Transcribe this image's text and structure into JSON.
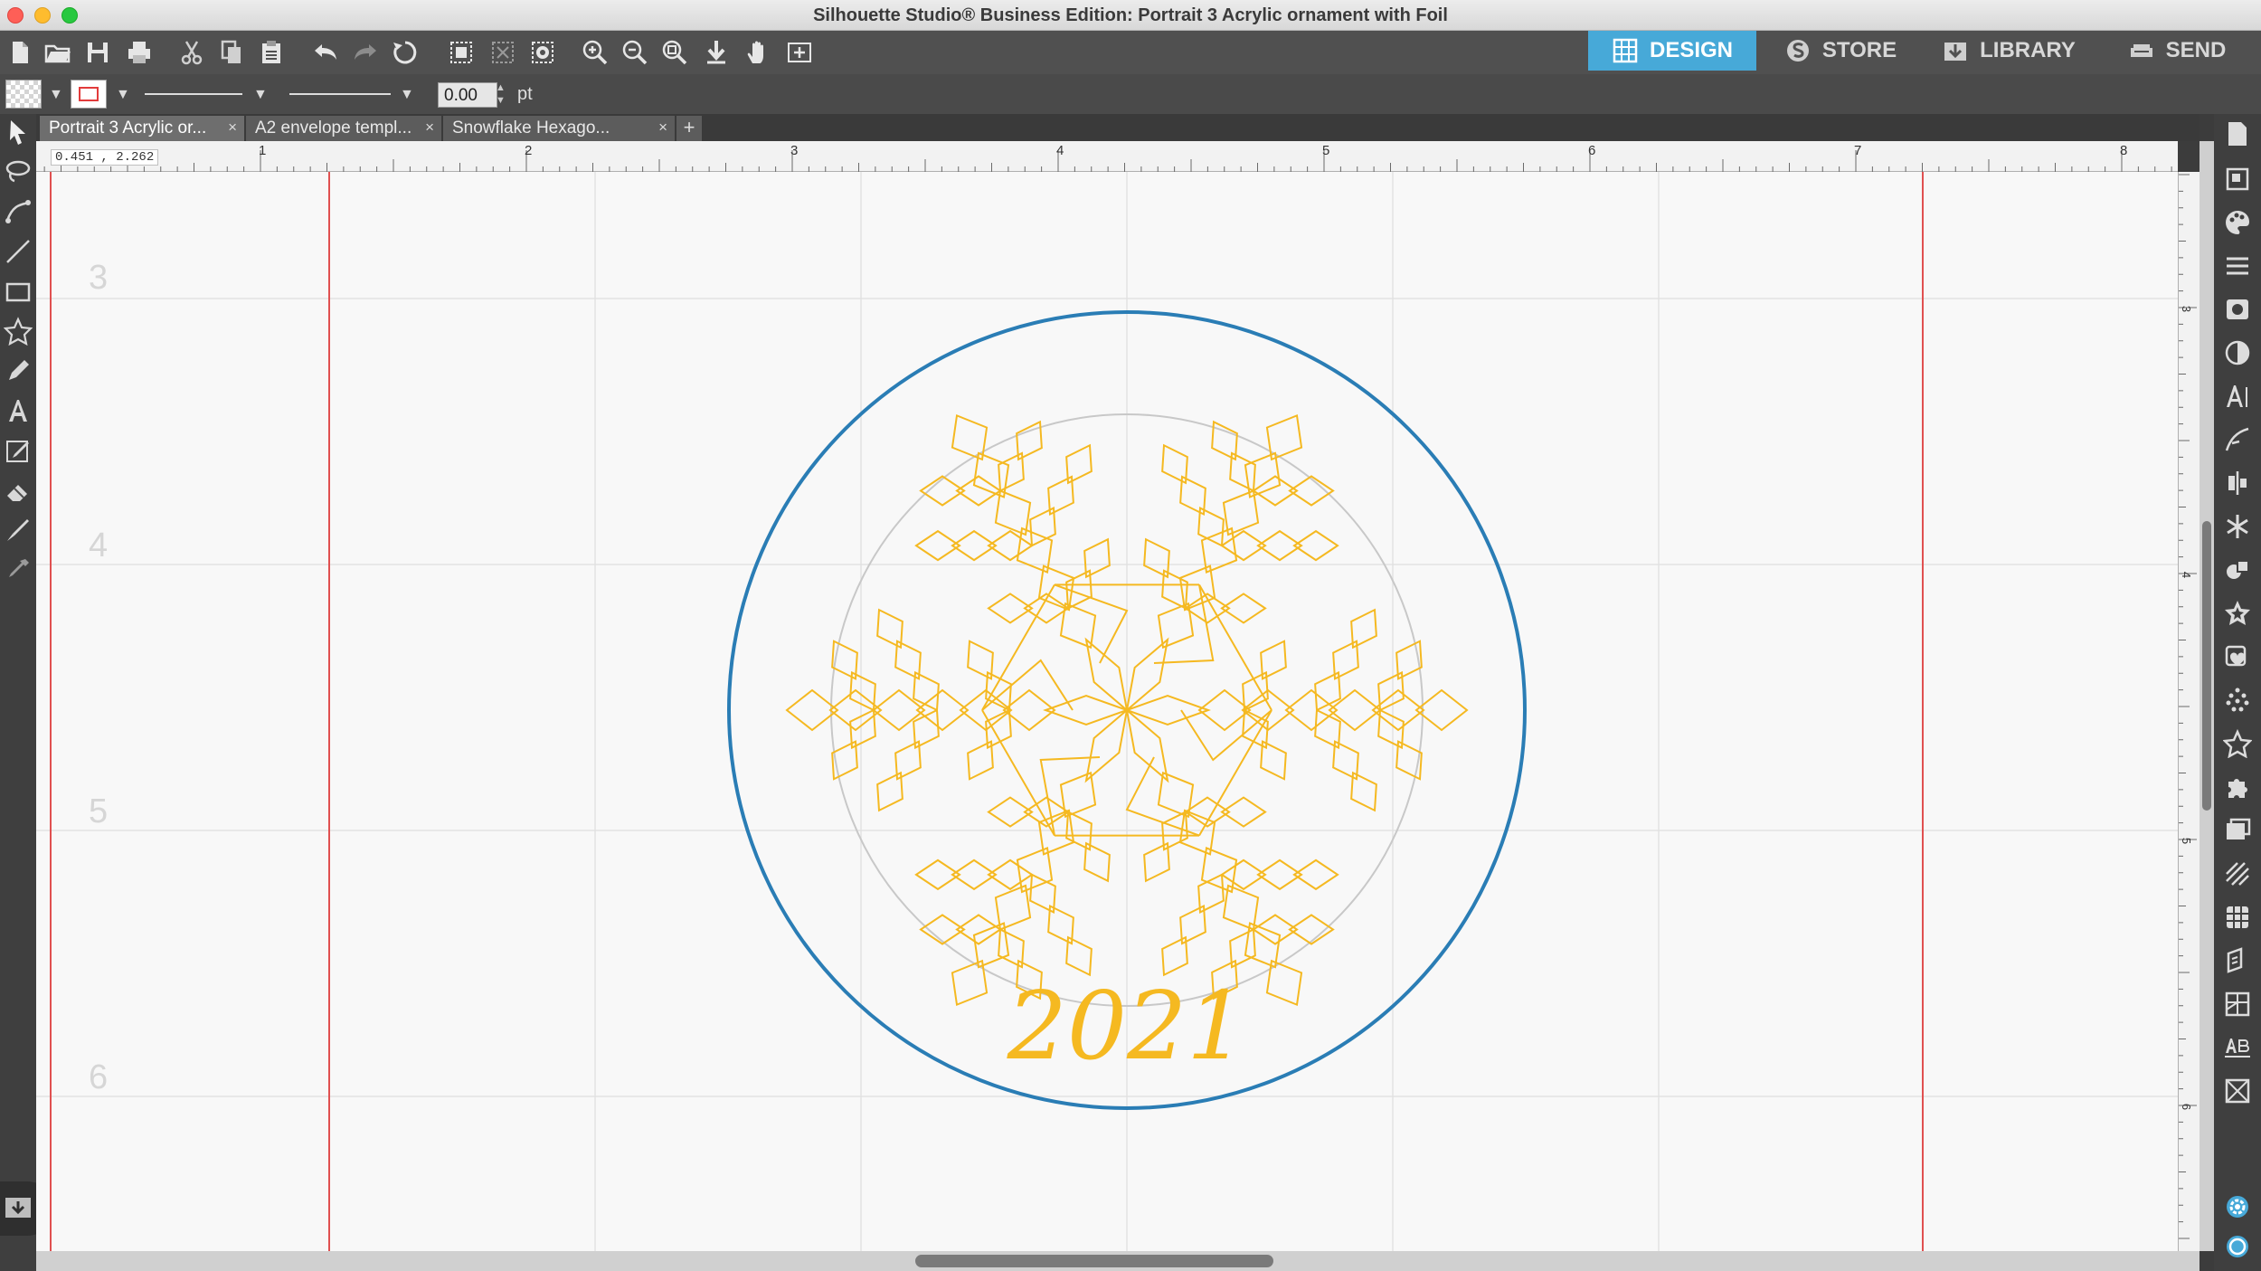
{
  "window": {
    "title": "Silhouette Studio® Business Edition: Portrait 3 Acrylic ornament with Foil"
  },
  "nav_tabs": [
    {
      "label": "DESIGN",
      "active": true,
      "icon": "grid-icon"
    },
    {
      "label": "STORE",
      "active": false,
      "icon": "silhouette-s-icon"
    },
    {
      "label": "LIBRARY",
      "active": false,
      "icon": "library-download-icon"
    },
    {
      "label": "SEND",
      "active": false,
      "icon": "cutter-icon"
    }
  ],
  "property_bar": {
    "line_width_value": "0.00",
    "line_width_unit": "pt"
  },
  "doc_tabs": [
    {
      "label": "Portrait 3 Acrylic or...",
      "active": true
    },
    {
      "label": "A2 envelope templ...",
      "active": false
    },
    {
      "label": "Snowflake Hexago...",
      "active": false
    }
  ],
  "add_tab_label": "+",
  "cursor_coords": "0.451 , 2.262",
  "ruler": {
    "horizontal": [
      "1",
      "2",
      "3",
      "4",
      "5",
      "6",
      "7",
      "8"
    ],
    "vertical": [
      "3",
      "4",
      "5",
      "6"
    ]
  },
  "canvas": {
    "page_numbers": [
      "3",
      "4",
      "5",
      "6"
    ],
    "ornament_text": "2021",
    "colors": {
      "cut_circle": "#2a7db5",
      "foil": "#f5b921",
      "inner_circle": "#c8c8c8",
      "margin_line": "#e05050"
    }
  }
}
